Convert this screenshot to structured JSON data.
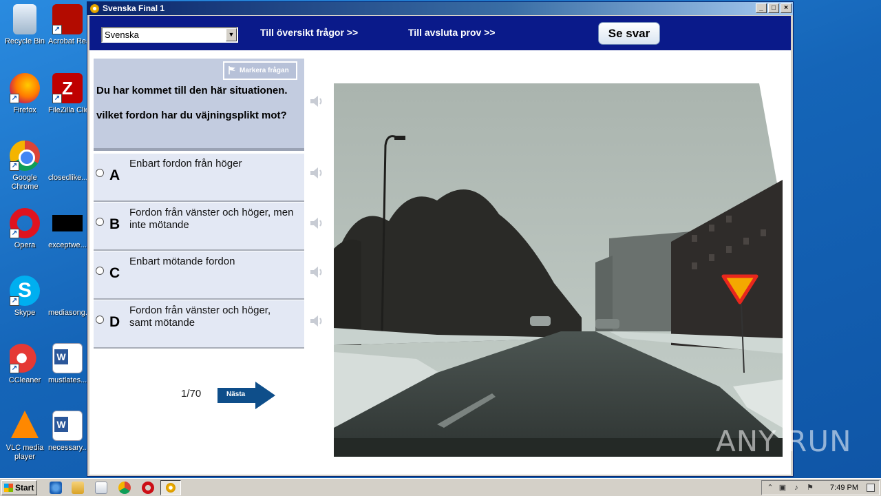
{
  "desktop": {
    "icons": [
      {
        "label": "Recycle Bin"
      },
      {
        "label": "Acrobat Reader DC"
      },
      {
        "label": "Firefox"
      },
      {
        "label": "FileZilla Client"
      },
      {
        "label": "Google Chrome"
      },
      {
        "label": "closedlike..."
      },
      {
        "label": "Opera"
      },
      {
        "label": "exceptwe..."
      },
      {
        "label": "Skype"
      },
      {
        "label": "mediasong..."
      },
      {
        "label": "CCleaner"
      },
      {
        "label": "mustlates..."
      },
      {
        "label": "VLC media player"
      },
      {
        "label": "necessary..."
      }
    ]
  },
  "window": {
    "title": "Svenska Final 1",
    "controls": {
      "minimize": "_",
      "maximize": "□",
      "close": "×"
    }
  },
  "toolbar": {
    "language_value": "Svenska",
    "overview_link": "Till översikt frågor >>",
    "finish_link": "Till avsluta prov  >>",
    "show_answer": "Se svar"
  },
  "question": {
    "flag_label": "Markera frågan",
    "text": "Du har kommet till den här situationen.\n\nvilket fordon har du väjningsplikt mot?"
  },
  "answers": [
    {
      "letter": "A",
      "text": "Enbart fordon från höger"
    },
    {
      "letter": "B",
      "text": "Fordon från vänster och höger, men inte mötande"
    },
    {
      "letter": "C",
      "text": "Enbart mötande fordon"
    },
    {
      "letter": "D",
      "text": "Fordon från vänster och höger, samt mötande"
    }
  ],
  "navigation": {
    "counter": "1/70",
    "next_label": "Nästa"
  },
  "watermark": "ANY RUN",
  "taskbar": {
    "start_label": "Start",
    "clock": "7:49 PM"
  },
  "colors": {
    "toolbar_bg": "#0a1a8a",
    "question_bg": "#c3cce0",
    "answer_bg": "#e3e8f4",
    "next_arrow": "#0e4e8a",
    "yield_sign": "#f4a800"
  }
}
